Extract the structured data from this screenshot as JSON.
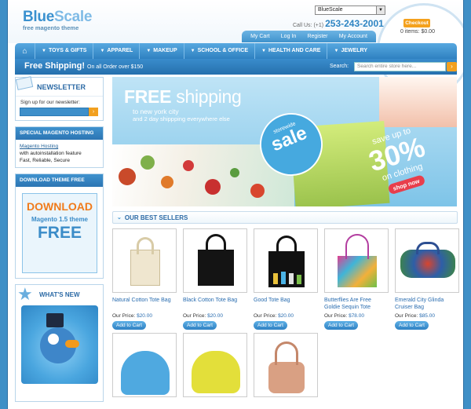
{
  "header": {
    "logo_part1": "Blue",
    "logo_part2": "Scale",
    "tagline": "free magento theme",
    "store_select": "BlueScale",
    "call_label": "Call Us: (+1)",
    "phone": "253-243-2001",
    "links": [
      "My Cart",
      "Log In",
      "Register",
      "My Account"
    ],
    "checkout_label": "Checkout",
    "cart_summary": "0 items: $0.00"
  },
  "nav": {
    "home_icon": "home-icon",
    "items": [
      "TOYS & GIFTS",
      "APPAREL",
      "MAKEUP",
      "SCHOOL & OFFICE",
      "HEALTH AND CARE",
      "JEWELRY"
    ]
  },
  "subbar": {
    "free_shipping": "Free Shipping!",
    "free_shipping_detail": "On all Order over $150",
    "search_label": "Search:",
    "search_placeholder": "Search entire store here..."
  },
  "sidebar": {
    "newsletter_title": "NEWSLETTER",
    "newsletter_text": "Sign up for our newsletter:",
    "hosting_title": "SPECIAL MAGENTO HOSTING",
    "hosting_link": "Magento Hosting",
    "hosting_line2": "with autoinstallation feature",
    "hosting_line3": "Fast, Reliable, Secure",
    "download_title": "DOWNLOAD THEME FREE",
    "download_word": "DOWNLOAD",
    "download_version": "Magento 1.5 theme",
    "download_free": "FREE",
    "whats_new_title": "WHAT'S NEW"
  },
  "banner": {
    "free": "FREE",
    "shipping": "shipping",
    "line1": "to new york city",
    "line2": "and 2 day shippping everywhere else",
    "storewide": "storewide",
    "sale": "sale",
    "save_up_to": "save up to",
    "percent": "30%",
    "on_clothing": "on clothing",
    "shop_now": "shop now"
  },
  "bestsellers": {
    "title": "OUR BEST SELLERS",
    "price_label": "Our Price:",
    "add_label": "Add to Cart",
    "products": [
      {
        "name": "Natural Cotton Tote Bag",
        "price": "$20.00"
      },
      {
        "name": "Black Cotton Tote Bag",
        "price": "$20.00"
      },
      {
        "name": "Good Tote Bag",
        "price": "$20.00"
      },
      {
        "name": "Butterflies Are Free Goldie Sequin Tote",
        "price": "$78.00"
      },
      {
        "name": "Emerald City Glinda Cruiser Bag",
        "price": "$85.00"
      }
    ]
  },
  "colors": {
    "brand_blue": "#3a91cf",
    "accent_orange": "#f2a01f",
    "link_blue": "#2a6db0"
  }
}
